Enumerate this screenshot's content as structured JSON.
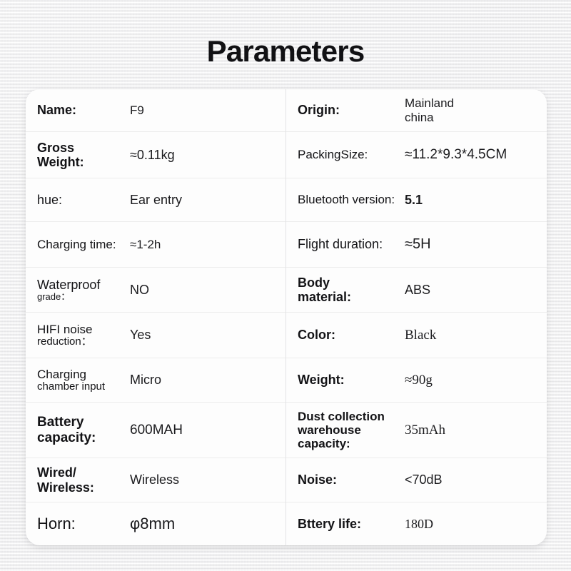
{
  "title": "Parameters",
  "colors": {
    "card_background": "#fdfdfd",
    "page_background": "#f2f2f2",
    "text": "#131316",
    "row_divider": "#ececec",
    "column_divider": "#e3e3e4"
  },
  "table": {
    "left_column": [
      {
        "label": "Name:",
        "value": "F9"
      },
      {
        "label": "Gross",
        "label_line2": "Weight:",
        "value": "≈0.11kg"
      },
      {
        "label": "hue:",
        "value": "Ear entry"
      },
      {
        "label": "Charging time:",
        "value": "≈1-2h"
      },
      {
        "label": "Waterproof",
        "label_line2": "grade：",
        "value": "NO"
      },
      {
        "label": "HIFI noise",
        "label_line2": "reduction：",
        "value": "Yes"
      },
      {
        "label": "Charging",
        "label_line2": "chamber input",
        "value": "Micro"
      },
      {
        "label": "Battery",
        "label_line2": "capacity:",
        "value": "600MAH"
      },
      {
        "label": "Wired/",
        "label_line2": "Wireless:",
        "value": "Wireless"
      },
      {
        "label": "Horn:",
        "value": "φ8mm"
      }
    ],
    "right_column": [
      {
        "label": "Origin:",
        "value": "Mainland",
        "value_line2": "china"
      },
      {
        "label": "PackingSize:",
        "value": "≈11.2*9.3*4.5CM"
      },
      {
        "label": "Bluetooth version:",
        "value": "5.1"
      },
      {
        "label": "Flight duration:",
        "value": "≈5H"
      },
      {
        "label": "Body",
        "label_line2": "material:",
        "value": "ABS"
      },
      {
        "label": "Color:",
        "value": "Black"
      },
      {
        "label": "Weight:",
        "value": "≈90g"
      },
      {
        "label": "Dust collection",
        "label_line2": "warehouse",
        "label_line3": "capacity:",
        "value": "35mAh"
      },
      {
        "label": "Noise:",
        "value": "<70dB"
      },
      {
        "label": "Bttery life:",
        "value": "180D"
      }
    ]
  }
}
